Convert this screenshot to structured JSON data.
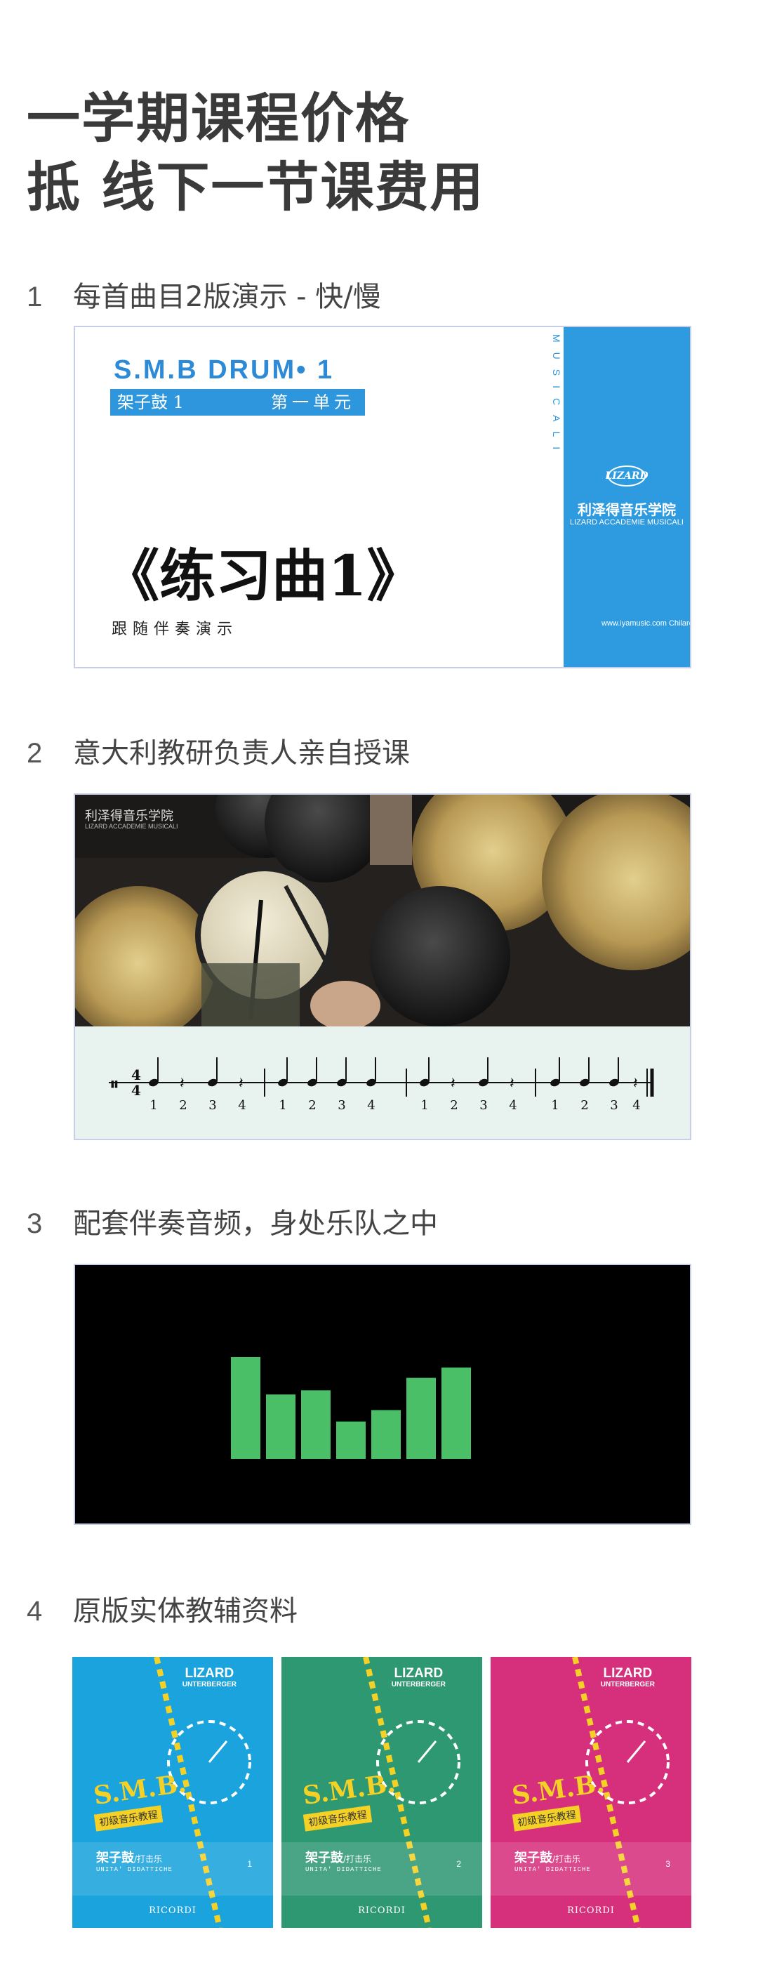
{
  "headline": {
    "line1": "一学期课程价格",
    "line2": "抵 线下一节课费用"
  },
  "sections": [
    {
      "num": "1",
      "title": "每首曲目2版演示 - 快/慢"
    },
    {
      "num": "2",
      "title": "意大利教研负责人亲自授课"
    },
    {
      "num": "3",
      "title": "配套伴奏音频，身处乐队之中"
    },
    {
      "num": "4",
      "title": "原版实体教辅资料"
    }
  ],
  "card1": {
    "brand": "S.M.B  DRUM• 1",
    "unit_left": "架子鼓  1",
    "unit_right": "第一单元",
    "title": "《练习曲1》",
    "subtitle": "跟随伴奏演示",
    "vertical_text": "LIZARD ACCADEMIE MUSICALI",
    "logo_text": "LIZARD",
    "school_cn": "利泽得音乐学院",
    "school_en": "LIZARD ACCADEMIE MUSICALI",
    "url": "www.iyamusic.com Chilarozzi"
  },
  "card2": {
    "watermark": "利泽得音乐学院",
    "watermark_en": "LIZARD ACCADEMIE MUSICALI",
    "beat_numbers": [
      "1",
      "2",
      "3",
      "4",
      "1",
      "2",
      "3",
      "4",
      "1",
      "2",
      "3",
      "4",
      "1",
      "2",
      "3",
      "4"
    ],
    "time_signature": "4/4"
  },
  "card3": {
    "bar_color": "#4bbf67",
    "levels": [
      0.98,
      0.62,
      0.66,
      0.36,
      0.47,
      0.78,
      0.88
    ]
  },
  "books": [
    {
      "color": "#1aa3dc",
      "publisher": "LIZARD",
      "publisher_sub": "UNTERBERGER",
      "title": "S.M.B.",
      "tag": "初级音乐教程",
      "name": "架子鼓",
      "name_sub": "/打击乐",
      "line2": "UNITA' DIDATTICHE",
      "number": "1",
      "footer": "RICORDI"
    },
    {
      "color": "#2e9873",
      "publisher": "LIZARD",
      "publisher_sub": "UNTERBERGER",
      "title": "S.M.B.",
      "tag": "初级音乐教程",
      "name": "架子鼓",
      "name_sub": "/打击乐",
      "line2": "UNITA' DIDATTICHE",
      "number": "2",
      "footer": "RICORDI"
    },
    {
      "color": "#d6307d",
      "publisher": "LIZARD",
      "publisher_sub": "UNTERBERGER",
      "title": "S.M.B.",
      "tag": "初级音乐教程",
      "name": "架子鼓",
      "name_sub": "/打击乐",
      "line2": "UNITA' DIDATTICHE",
      "number": "3",
      "footer": "RICORDI"
    }
  ]
}
